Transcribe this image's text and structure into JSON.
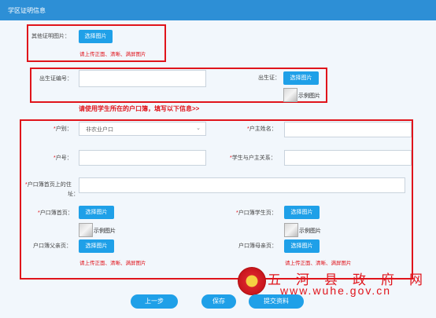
{
  "header": {
    "title": "学区证明信息"
  },
  "other_proof": {
    "label": "其他证明图片：",
    "button": "选择图片",
    "hint": "请上传正面、清晰、满屏图片"
  },
  "birth": {
    "cert_no_label": "出生证编号：",
    "cert_label": "出生证：",
    "button": "选择图片",
    "sample": "示例图片"
  },
  "notice": "请使用学生所在的户口簿，填写以下信息>>",
  "household": {
    "type_label": "户别：",
    "type_value": "非农业户口",
    "head_name_label": "户主姓名：",
    "number_label": "户号：",
    "relation_label": "学生与户主关系：",
    "address_label_line1": "户口簿首页上的住",
    "address_label_line2": "址：",
    "first_page_label": "户口簿首页：",
    "student_page_label": "户口簿学生页：",
    "father_page_label": "户口簿父亲页：",
    "mother_page_label": "户口簿母亲页：",
    "button": "选择图片",
    "sample": "示例图片",
    "hint": "请上传正面、清晰、满屏图片",
    "required_mark": "*"
  },
  "actions": {
    "prev": "上一步",
    "save": "保存",
    "submit": "提交资料"
  },
  "watermark": {
    "name": "五一河一县一政一府一网",
    "url": "www.wuhe.gov.cn"
  },
  "colors": {
    "accent": "#1fa0e8",
    "header": "#2d8fd6",
    "alert": "#e0141b"
  }
}
